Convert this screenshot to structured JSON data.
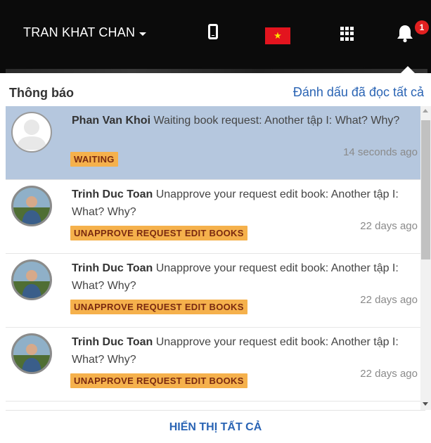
{
  "topbar": {
    "username": "TRAN KHAT CHAN",
    "notification_count": "1",
    "flag_star": "★"
  },
  "panel": {
    "title": "Thông báo",
    "mark_all_read": "Đánh dấu đã đọc tất cả",
    "show_all": "HIỂN THỊ TẤT CẢ"
  },
  "notifications": [
    {
      "author": "Phan Van Khoi",
      "message": " Waiting book request: Another tập I: What? Why?",
      "tag": "WAITING",
      "time": "14 seconds ago",
      "unread": true
    },
    {
      "author": "Trinh Duc Toan",
      "message": " Unapprove your request edit book: Another tập I: What? Why?",
      "tag": "UNAPPROVE REQUEST EDIT BOOKS",
      "time": "22 days ago",
      "unread": false
    },
    {
      "author": "Trinh Duc Toan",
      "message": " Unapprove your request edit book: Another tập I: What? Why?",
      "tag": "UNAPPROVE REQUEST EDIT BOOKS",
      "time": "22 days ago",
      "unread": false
    },
    {
      "author": "Trinh Duc Toan",
      "message": " Unapprove your request edit book: Another tập I: What? Why?",
      "tag": "UNAPPROVE REQUEST EDIT BOOKS",
      "time": "22 days ago",
      "unread": false
    }
  ],
  "colors": {
    "accent": "#2a64b4",
    "unread_bg": "#b5c7de",
    "tag_bg": "#f5b14c",
    "badge": "#e22020"
  },
  "icons": [
    "phone-icon",
    "vietnam-flag-icon",
    "apps-grid-icon",
    "bell-icon",
    "user-placeholder-icon",
    "user-photo-avatar"
  ]
}
